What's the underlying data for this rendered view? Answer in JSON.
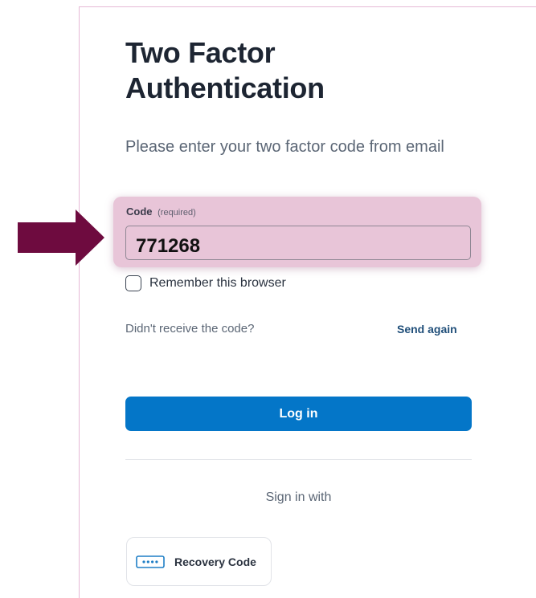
{
  "heading": {
    "title": "Two Factor Authentication",
    "subtitle": "Please enter your two factor code from email"
  },
  "code_field": {
    "label": "Code",
    "required_note": "(required)",
    "value": "771268"
  },
  "remember": {
    "label": "Remember this browser",
    "checked": false
  },
  "resend": {
    "prompt": "Didn't receive the code?",
    "action": "Send again"
  },
  "login": {
    "label": "Log in",
    "color": "#0476c8"
  },
  "alternatives": {
    "heading": "Sign in with",
    "recovery_code_label": "Recovery Code",
    "recovery_icon": "password-dots-icon"
  },
  "annotation": {
    "arrow_color": "#6e0b3f",
    "highlight_color": "#e8c5d8"
  }
}
